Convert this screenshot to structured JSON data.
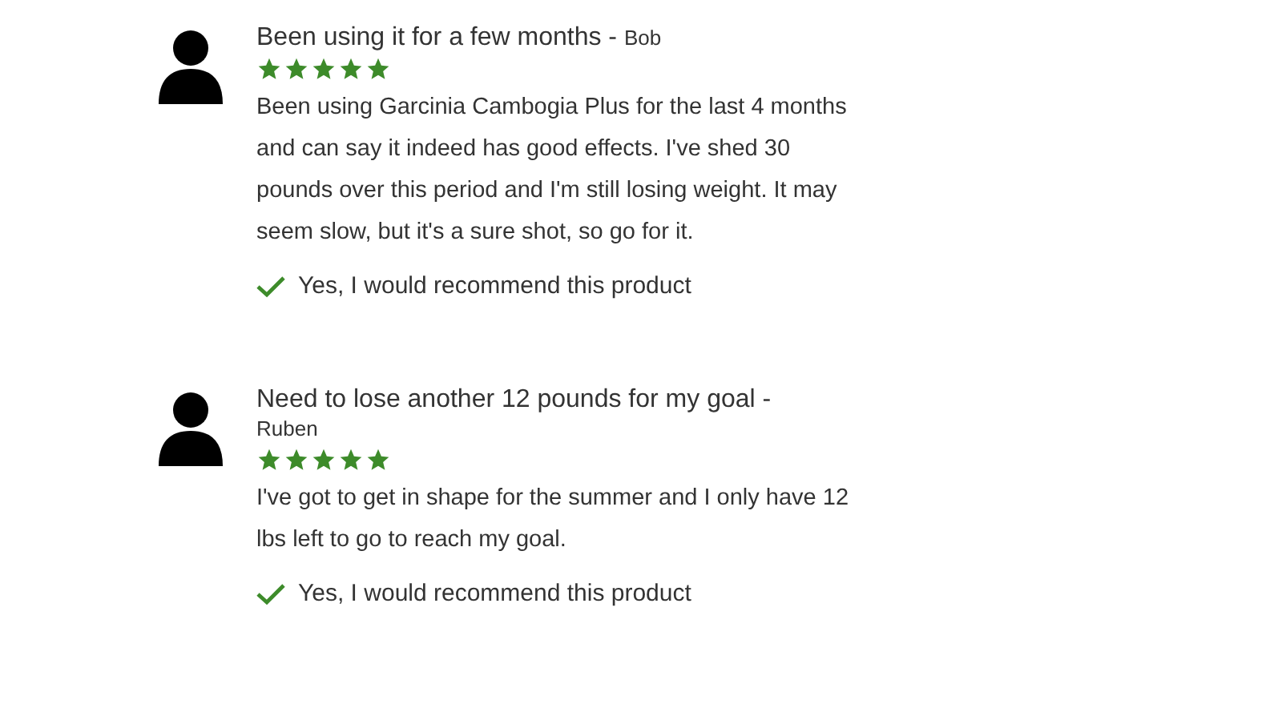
{
  "reviews": [
    {
      "title": "Been using it for a few months -",
      "author": "Bob",
      "stars": 5,
      "body": "Been using Garcinia Cambogia Plus for the last 4 months and can say it indeed has good effects. I've shed 30 pounds over this period and I'm still losing weight. It may seem slow, but it's a sure shot, so go for it.",
      "recommended": true,
      "recommendation": "Yes, I would recommend this product"
    },
    {
      "title": "Need to lose another 12 pounds for my goal -",
      "author": "Ruben",
      "stars": 5,
      "body": "I've got to get in shape for the summer and I only have 12 lbs left to go to reach my goal.",
      "recommended": true,
      "recommendation": "Yes, I would recommend this product"
    }
  ]
}
